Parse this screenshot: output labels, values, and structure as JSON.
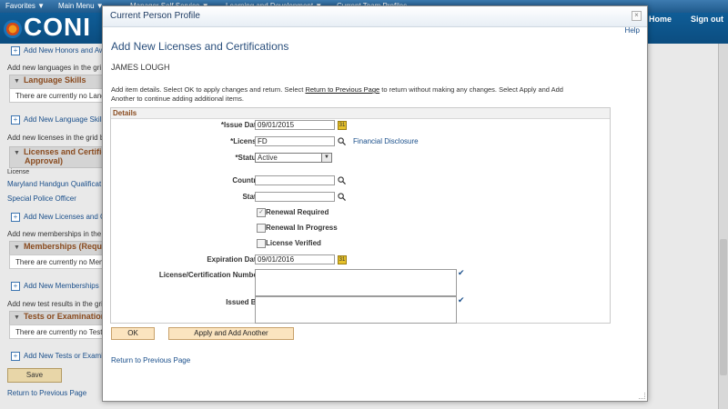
{
  "topnav": {
    "items": [
      "Favorites ▼",
      "Main Menu ▼",
      "Manager Self Service ▼",
      "Learning and Development ▼",
      "Current Team Profiles"
    ],
    "home": "Home",
    "signout": "Sign out"
  },
  "header": {
    "logo_text": "CONI"
  },
  "background": {
    "rows": [
      "Add New Honors and Awa",
      "Add new languages in the gri",
      "Language Skills",
      "There are currently no Lang",
      "Add New Language Skills",
      "Add new licenses in the grid b",
      "Licenses and Certific",
      "Approval)",
      "License",
      "Maryland Handgun Qualificat",
      "Special Police Officer",
      "Add New Licenses and Ce",
      "Add new memberships in the",
      "Memberships (Requir",
      "There are currently no Mem",
      "Add New Memberships",
      "Add new test results in the gri",
      "Tests or Examination",
      "There are currently no Tests",
      "Add New Tests or Examin"
    ],
    "save": "Save",
    "return": "Return to Previous Page"
  },
  "modal": {
    "title": "Current Person Profile",
    "close": "×",
    "help": "Help",
    "heading": "Add New Licenses and Certifications",
    "person": "JAMES LOUGH",
    "instr_1": "Add item details. Select OK to apply changes and return. Select ",
    "instr_link": "Return to Previous Page",
    "instr_2": " to return without making any changes. Select Apply and Add Another to continue adding additional items.",
    "details_title": "Details",
    "fields": {
      "issue_date_label": "*Issue Date",
      "issue_date_value": "09/01/2015",
      "license_label": "*License",
      "license_value": "FD",
      "license_desc": "Financial Disclosure",
      "status_label": "*Status",
      "status_value": "Active",
      "country_label": "Country",
      "country_value": "",
      "state_label": "State",
      "state_value": "",
      "renewal_required": "Renewal Required",
      "renewal_in_progress": "Renewal In Progress",
      "license_verified": "License Verified",
      "expiration_label": "Expiration Date",
      "expiration_value": "09/01/2016",
      "cert_number_label": "License/Certification Number",
      "issued_by_label": "Issued By"
    },
    "ok": "OK",
    "apply_another": "Apply and Add Another",
    "return": "Return to Previous Page"
  },
  "colors": {
    "accent": "#1a4f8b",
    "header": "#0f5d97",
    "section_title": "#8a4b1f",
    "button": "#fbe4bf"
  }
}
